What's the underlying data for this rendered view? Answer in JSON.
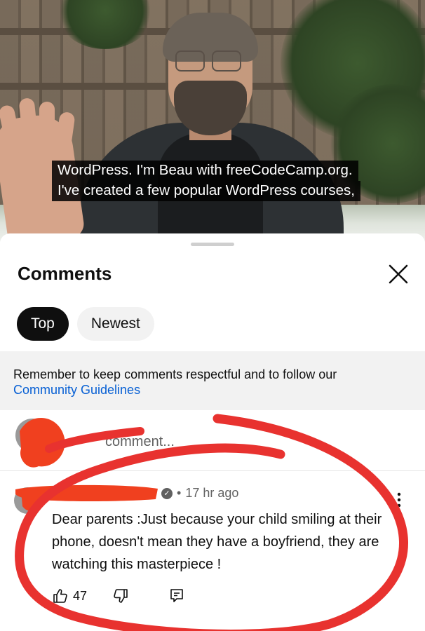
{
  "video": {
    "captions": [
      "WordPress. I'm Beau with freeCodeCamp.org.",
      "I've created a few popular WordPress courses,"
    ]
  },
  "comments_panel": {
    "title": "Comments",
    "filters": [
      {
        "label": "Top",
        "active": true
      },
      {
        "label": "Newest",
        "active": false
      }
    ],
    "notice": {
      "text": "Remember to keep comments respectful and to follow our",
      "link": "Community Guidelines"
    },
    "add_comment": {
      "placeholder": "comment..."
    },
    "comments": [
      {
        "time": "17 hr ago",
        "text": "Dear parents :Just because your child smiling at their phone, doesn't mean they have a boyfriend, they are watching this masterpiece !",
        "likes": "47"
      }
    ]
  },
  "colors": {
    "accent_link": "#065fd4",
    "chip_active_bg": "#0f0f0f",
    "annotation_red": "#e8322f"
  },
  "icons": [
    "close-icon",
    "like-icon",
    "dislike-icon",
    "reply-icon",
    "more-vert-icon",
    "verified-icon"
  ]
}
